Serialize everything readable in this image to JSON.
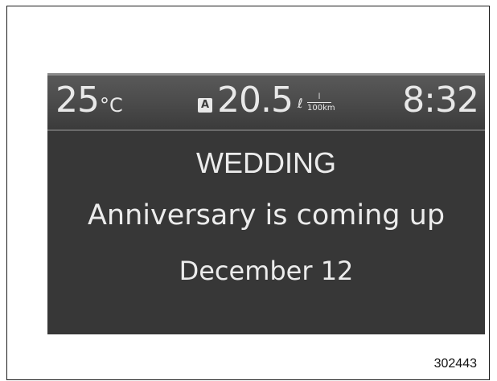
{
  "status_bar": {
    "temperature": "25",
    "temperature_unit": "°C",
    "econ_badge": "A",
    "fuel_economy": "20.5",
    "fuel_unit_prefix": "ℓ",
    "fuel_unit_top": "l",
    "fuel_unit_bottom": "100km",
    "time": "8:32"
  },
  "message": {
    "line1": "WEDDING",
    "line2": "Anniversary is coming up",
    "line3": "December  12"
  },
  "figure_code": "302443",
  "colors": {
    "screen_bg": "#373737",
    "bar_bg": "#4a4a4a",
    "text": "#e8e8e8"
  }
}
